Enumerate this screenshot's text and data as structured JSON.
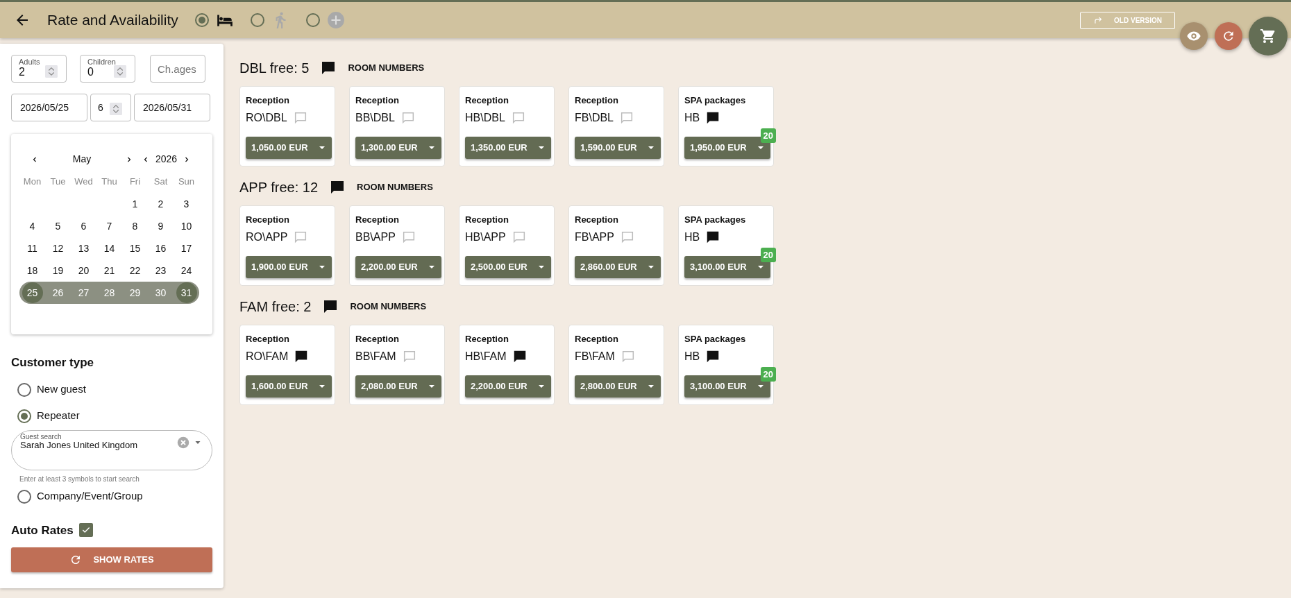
{
  "header": {
    "title": "Rate and Availability",
    "modes": [
      {
        "selected": true
      },
      {
        "selected": false
      },
      {
        "selected": false
      }
    ],
    "old_version_label": "OLD VERSION"
  },
  "stay": {
    "adults": {
      "label": "Adults",
      "value": "2"
    },
    "children": {
      "label": "Children",
      "value": "0"
    },
    "ages": {
      "placeholder": "Ch.ages"
    },
    "checkin": "2026/05/25",
    "nights": "6",
    "checkout": "2026/05/31"
  },
  "calendar": {
    "month": "May",
    "year": "2026",
    "weekdays": [
      "Mon",
      "Tue",
      "Wed",
      "Thu",
      "Fri",
      "Sat",
      "Sun"
    ],
    "weeks": [
      [
        {
          "kind": "blank"
        },
        {
          "kind": "blank"
        },
        {
          "kind": "blank"
        },
        {
          "kind": "blank"
        },
        {
          "label": "1",
          "kind": "plain"
        },
        {
          "label": "2",
          "kind": "plain"
        },
        {
          "label": "3",
          "kind": "plain"
        }
      ],
      [
        {
          "label": "4",
          "kind": "plain"
        },
        {
          "label": "5",
          "kind": "plain"
        },
        {
          "label": "6",
          "kind": "plain"
        },
        {
          "label": "7",
          "kind": "plain"
        },
        {
          "label": "8",
          "kind": "plain"
        },
        {
          "label": "9",
          "kind": "plain"
        },
        {
          "label": "10",
          "kind": "plain"
        }
      ],
      [
        {
          "label": "11",
          "kind": "plain"
        },
        {
          "label": "12",
          "kind": "plain"
        },
        {
          "label": "13",
          "kind": "plain"
        },
        {
          "label": "14",
          "kind": "plain"
        },
        {
          "label": "15",
          "kind": "plain"
        },
        {
          "label": "16",
          "kind": "plain"
        },
        {
          "label": "17",
          "kind": "plain"
        }
      ],
      [
        {
          "label": "18",
          "kind": "plain"
        },
        {
          "label": "19",
          "kind": "plain"
        },
        {
          "label": "20",
          "kind": "plain"
        },
        {
          "label": "21",
          "kind": "plain"
        },
        {
          "label": "22",
          "kind": "plain"
        },
        {
          "label": "23",
          "kind": "plain"
        },
        {
          "label": "24",
          "kind": "plain"
        }
      ],
      [
        {
          "label": "25",
          "kind": "start"
        },
        {
          "label": "26",
          "kind": "inside"
        },
        {
          "label": "27",
          "kind": "inside"
        },
        {
          "label": "28",
          "kind": "inside"
        },
        {
          "label": "29",
          "kind": "inside"
        },
        {
          "label": "30",
          "kind": "inside"
        },
        {
          "label": "31",
          "kind": "end"
        }
      ]
    ]
  },
  "customer_type": {
    "title": "Customer type",
    "options": [
      {
        "label": "New guest",
        "selected": false
      },
      {
        "label": "Repeater",
        "selected": true
      },
      {
        "label": "Company/Event/Group",
        "selected": false
      }
    ],
    "guest_search": {
      "label": "Guest search",
      "value": "Sarah Jones United Kingdom",
      "hint": "Enter at least 3 symbols to start search"
    }
  },
  "auto_rates": {
    "label": "Auto Rates",
    "checked": true
  },
  "show_rates_label": "SHOW RATES",
  "room_types": [
    {
      "title": "DBL free: 5",
      "note": true,
      "link_label": "ROOM NUMBERS",
      "rates": [
        {
          "channel": "Reception",
          "plan": "RO\\DBL",
          "note": false,
          "price": "1,050.00 EUR"
        },
        {
          "channel": "Reception",
          "plan": "BB\\DBL",
          "note": false,
          "price": "1,300.00 EUR"
        },
        {
          "channel": "Reception",
          "plan": "HB\\DBL",
          "note": false,
          "price": "1,350.00 EUR"
        },
        {
          "channel": "Reception",
          "plan": "FB\\DBL",
          "note": false,
          "price": "1,590.00 EUR"
        },
        {
          "channel": "SPA packages",
          "plan": "HB",
          "note": true,
          "price": "1,950.00 EUR",
          "badge": "20"
        }
      ]
    },
    {
      "title": "APP free: 12",
      "note": true,
      "link_label": "ROOM NUMBERS",
      "rates": [
        {
          "channel": "Reception",
          "plan": "RO\\APP",
          "note": false,
          "price": "1,900.00 EUR"
        },
        {
          "channel": "Reception",
          "plan": "BB\\APP",
          "note": false,
          "price": "2,200.00 EUR"
        },
        {
          "channel": "Reception",
          "plan": "HB\\APP",
          "note": false,
          "price": "2,500.00 EUR"
        },
        {
          "channel": "Reception",
          "plan": "FB\\APP",
          "note": false,
          "price": "2,860.00 EUR"
        },
        {
          "channel": "SPA packages",
          "plan": "HB",
          "note": true,
          "price": "3,100.00 EUR",
          "badge": "20"
        }
      ]
    },
    {
      "title": "FAM free: 2",
      "note": true,
      "link_label": "ROOM NUMBERS",
      "rates": [
        {
          "channel": "Reception",
          "plan": "RO\\FAM",
          "note": true,
          "price": "1,600.00 EUR"
        },
        {
          "channel": "Reception",
          "plan": "BB\\FAM",
          "note": false,
          "price": "2,080.00 EUR"
        },
        {
          "channel": "Reception",
          "plan": "HB\\FAM",
          "note": true,
          "price": "2,200.00 EUR"
        },
        {
          "channel": "Reception",
          "plan": "FB\\FAM",
          "note": false,
          "price": "2,800.00 EUR"
        },
        {
          "channel": "SPA packages",
          "plan": "HB",
          "note": true,
          "price": "3,100.00 EUR",
          "badge": "20"
        }
      ]
    }
  ]
}
